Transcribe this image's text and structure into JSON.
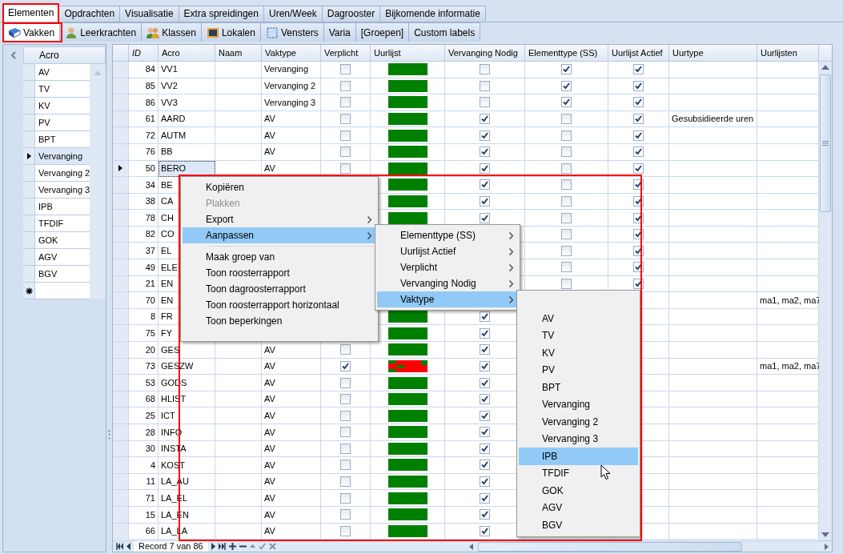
{
  "main_tabs": [
    {
      "label": "Elementen",
      "selected": true
    },
    {
      "label": "Opdrachten",
      "selected": false
    },
    {
      "label": "Visualisatie",
      "selected": false
    },
    {
      "label": "Extra spreidingen",
      "selected": false
    },
    {
      "label": "Uren/Week",
      "selected": false
    },
    {
      "label": "Dagrooster",
      "selected": false
    },
    {
      "label": "Bijkomende informatie",
      "selected": false
    }
  ],
  "sub_tabs": [
    {
      "label": "Vakken",
      "selected": true
    },
    {
      "label": "Leerkrachten",
      "selected": false
    },
    {
      "label": "Klassen",
      "selected": false
    },
    {
      "label": "Lokalen",
      "selected": false
    },
    {
      "label": "Vensters",
      "selected": false
    },
    {
      "label": "Varia",
      "selected": false
    },
    {
      "label": "[Groepen]",
      "selected": false
    },
    {
      "label": "Custom labels",
      "selected": false
    }
  ],
  "left_panel": {
    "column": "Acro",
    "rows": [
      {
        "acro": "AV",
        "selected": false
      },
      {
        "acro": "TV",
        "selected": false
      },
      {
        "acro": "KV",
        "selected": false
      },
      {
        "acro": "PV",
        "selected": false
      },
      {
        "acro": "BPT",
        "selected": false
      },
      {
        "acro": "Vervanging",
        "selected": true
      },
      {
        "acro": "Vervanging 2",
        "selected": false
      },
      {
        "acro": "Vervanging 3",
        "selected": false
      },
      {
        "acro": "IPB",
        "selected": false
      },
      {
        "acro": "TFDIF",
        "selected": false
      },
      {
        "acro": "GOK",
        "selected": false
      },
      {
        "acro": "AGV",
        "selected": false
      },
      {
        "acro": "BGV",
        "selected": false
      }
    ]
  },
  "grid": {
    "columns": [
      "ID",
      "Acro",
      "Naam",
      "Vaktype",
      "Verplicht",
      "Uurlijst",
      "Vervanging Nodig",
      "Elementtype (SS)",
      "Uurlijst Actief",
      "Uurtype",
      "Uurlijsten"
    ],
    "rows": [
      {
        "id": "84",
        "acro": "VV1",
        "vaktype": "Vervanging",
        "verplicht": false,
        "uurlijst_conflict": false,
        "vervanging_nodig": false,
        "elementtype_ss": true,
        "uurlijst_actief": true,
        "selected": false
      },
      {
        "id": "85",
        "acro": "VV2",
        "vaktype": "Vervanging 2",
        "verplicht": false,
        "uurlijst_conflict": false,
        "vervanging_nodig": false,
        "elementtype_ss": true,
        "uurlijst_actief": true,
        "selected": false
      },
      {
        "id": "86",
        "acro": "VV3",
        "vaktype": "Vervanging 3",
        "verplicht": false,
        "uurlijst_conflict": false,
        "vervanging_nodig": false,
        "elementtype_ss": true,
        "uurlijst_actief": true,
        "selected": false
      },
      {
        "id": "61",
        "acro": "AARD",
        "vaktype": "AV",
        "verplicht": false,
        "uurlijst_conflict": false,
        "vervanging_nodig": true,
        "elementtype_ss": false,
        "uurlijst_actief": true,
        "uurtype": "Gesubsidieerde uren",
        "selected": false
      },
      {
        "id": "72",
        "acro": "AUTM",
        "vaktype": "AV",
        "verplicht": false,
        "uurlijst_conflict": false,
        "vervanging_nodig": true,
        "elementtype_ss": false,
        "uurlijst_actief": true,
        "selected": false
      },
      {
        "id": "76",
        "acro": "BB",
        "vaktype": "AV",
        "verplicht": false,
        "uurlijst_conflict": false,
        "vervanging_nodig": true,
        "elementtype_ss": false,
        "uurlijst_actief": true,
        "selected": false
      },
      {
        "id": "50",
        "acro": "BERO",
        "vaktype": "AV",
        "verplicht": false,
        "uurlijst_conflict": false,
        "vervanging_nodig": true,
        "elementtype_ss": false,
        "uurlijst_actief": true,
        "selected": true
      },
      {
        "id": "34",
        "acro": "BE",
        "uurlijst_conflict": false,
        "vervanging_nodig": true,
        "elementtype_ss": false,
        "uurlijst_actief": true,
        "selected": false
      },
      {
        "id": "38",
        "acro": "CA",
        "uurlijst_conflict": false,
        "vervanging_nodig": true,
        "elementtype_ss": false,
        "uurlijst_actief": true,
        "selected": false
      },
      {
        "id": "78",
        "acro": "CH",
        "uurlijst_conflict": false,
        "vervanging_nodig": true,
        "elementtype_ss": false,
        "uurlijst_actief": true,
        "selected": false
      },
      {
        "id": "82",
        "acro": "CO",
        "elementtype_ss": false,
        "uurlijst_actief": true,
        "selected": false
      },
      {
        "id": "37",
        "acro": "EL",
        "elementtype_ss": false,
        "uurlijst_actief": true,
        "selected": false
      },
      {
        "id": "49",
        "acro": "ELE",
        "elementtype_ss": false,
        "uurlijst_actief": true,
        "selected": false
      },
      {
        "id": "21",
        "acro": "EN",
        "elementtype_ss": false,
        "uurlijst_actief": true,
        "selected": false
      },
      {
        "id": "70",
        "acro": "EN",
        "uurlijsten": "ma1, ma2, ma7",
        "selected": false
      },
      {
        "id": "8",
        "acro": "FR",
        "uurlijst_conflict": false,
        "vervanging_nodig": true,
        "selected": false
      },
      {
        "id": "75",
        "acro": "FY",
        "uurlijst_conflict": false,
        "vervanging_nodig": true,
        "selected": false
      },
      {
        "id": "20",
        "acro": "GES",
        "vaktype": "AV",
        "verplicht": false,
        "uurlijst_conflict": false,
        "vervanging_nodig": true,
        "selected": false
      },
      {
        "id": "73",
        "acro": "GESZW",
        "vaktype": "AV",
        "verplicht": true,
        "uurlijst_conflict": true,
        "vervanging_nodig": true,
        "uurlijsten": "ma1, ma2, ma7",
        "selected": false
      },
      {
        "id": "53",
        "acro": "GODS",
        "vaktype": "AV",
        "verplicht": false,
        "uurlijst_conflict": false,
        "vervanging_nodig": true,
        "selected": false
      },
      {
        "id": "68",
        "acro": "HLIST",
        "vaktype": "AV",
        "verplicht": false,
        "uurlijst_conflict": false,
        "vervanging_nodig": true,
        "selected": false
      },
      {
        "id": "25",
        "acro": "ICT",
        "vaktype": "AV",
        "verplicht": false,
        "uurlijst_conflict": false,
        "vervanging_nodig": true,
        "selected": false
      },
      {
        "id": "28",
        "acro": "INFO",
        "vaktype": "AV",
        "verplicht": false,
        "uurlijst_conflict": false,
        "vervanging_nodig": true,
        "selected": false
      },
      {
        "id": "30",
        "acro": "INSTA",
        "vaktype": "AV",
        "verplicht": false,
        "uurlijst_conflict": false,
        "vervanging_nodig": true,
        "selected": false
      },
      {
        "id": "4",
        "acro": "KOST",
        "vaktype": "AV",
        "verplicht": false,
        "uurlijst_conflict": false,
        "vervanging_nodig": true,
        "selected": false
      },
      {
        "id": "11",
        "acro": "LA_AU",
        "vaktype": "AV",
        "verplicht": false,
        "uurlijst_conflict": false,
        "vervanging_nodig": true,
        "selected": false
      },
      {
        "id": "71",
        "acro": "LA_EL",
        "vaktype": "AV",
        "verplicht": false,
        "uurlijst_conflict": false,
        "vervanging_nodig": true,
        "selected": false
      },
      {
        "id": "15",
        "acro": "LA_EN",
        "vaktype": "AV",
        "verplicht": false,
        "uurlijst_conflict": false,
        "vervanging_nodig": true,
        "selected": false
      },
      {
        "id": "66",
        "acro": "LA_LA",
        "vaktype": "AV",
        "verplicht": false,
        "uurlijst_conflict": false,
        "vervanging_nodig": true,
        "selected": false
      }
    ],
    "navigator": {
      "record_text": "Record 7 van 86"
    }
  },
  "context_menu": {
    "items": [
      {
        "kind": "command",
        "label": "Kopiëren",
        "disabled": false,
        "submenu": false,
        "selected": false
      },
      {
        "kind": "command",
        "label": "Plakken",
        "disabled": true,
        "submenu": false,
        "selected": false
      },
      {
        "kind": "command",
        "label": "Export",
        "disabled": false,
        "submenu": true,
        "selected": false
      },
      {
        "kind": "command",
        "label": "Aanpassen",
        "disabled": false,
        "submenu": true,
        "selected": true
      },
      {
        "kind": "separator"
      },
      {
        "kind": "command",
        "label": "Maak groep van",
        "disabled": false,
        "submenu": false,
        "selected": false
      },
      {
        "kind": "command",
        "label": "Toon roosterrapport",
        "disabled": false,
        "submenu": false,
        "selected": false
      },
      {
        "kind": "command",
        "label": "Toon dagroosterrapport",
        "disabled": false,
        "submenu": false,
        "selected": false
      },
      {
        "kind": "command",
        "label": "Toon roosterrapport horizontaal",
        "disabled": false,
        "submenu": false,
        "selected": false
      },
      {
        "kind": "command",
        "label": "Toon beperkingen",
        "disabled": false,
        "submenu": false,
        "selected": false
      }
    ]
  },
  "submenu_aanpassen": {
    "items": [
      {
        "kind": "command",
        "label": "Elementtype (SS)",
        "disabled": false,
        "submenu": true,
        "selected": false
      },
      {
        "kind": "command",
        "label": "Uurlijst Actief",
        "disabled": false,
        "submenu": true,
        "selected": false
      },
      {
        "kind": "command",
        "label": "Verplicht",
        "disabled": false,
        "submenu": true,
        "selected": false
      },
      {
        "kind": "command",
        "label": "Vervanging Nodig",
        "disabled": false,
        "submenu": true,
        "selected": false
      },
      {
        "kind": "command",
        "label": "Vaktype",
        "disabled": false,
        "submenu": true,
        "selected": true
      }
    ]
  },
  "submenu_vaktype": {
    "items": [
      {
        "kind": "command",
        "label": "AV",
        "disabled": false,
        "submenu": false,
        "selected": false
      },
      {
        "kind": "command",
        "label": "TV",
        "disabled": false,
        "submenu": false,
        "selected": false
      },
      {
        "kind": "command",
        "label": "KV",
        "disabled": false,
        "submenu": false,
        "selected": false
      },
      {
        "kind": "command",
        "label": "PV",
        "disabled": false,
        "submenu": false,
        "selected": false
      },
      {
        "kind": "command",
        "label": "BPT",
        "disabled": false,
        "submenu": false,
        "selected": false
      },
      {
        "kind": "command",
        "label": "Vervanging",
        "disabled": false,
        "submenu": false,
        "selected": false
      },
      {
        "kind": "command",
        "label": "Vervanging 2",
        "disabled": false,
        "submenu": false,
        "selected": false
      },
      {
        "kind": "command",
        "label": "Vervanging 3",
        "disabled": false,
        "submenu": false,
        "selected": false
      },
      {
        "kind": "command",
        "label": "IPB",
        "disabled": false,
        "submenu": false,
        "selected": true
      },
      {
        "kind": "command",
        "label": "TFDIF",
        "disabled": false,
        "submenu": false,
        "selected": false
      },
      {
        "kind": "command",
        "label": "GOK",
        "disabled": false,
        "submenu": false,
        "selected": false
      },
      {
        "kind": "command",
        "label": "AGV",
        "disabled": false,
        "submenu": false,
        "selected": false
      },
      {
        "kind": "command",
        "label": "BGV",
        "disabled": false,
        "submenu": false,
        "selected": false
      }
    ]
  }
}
